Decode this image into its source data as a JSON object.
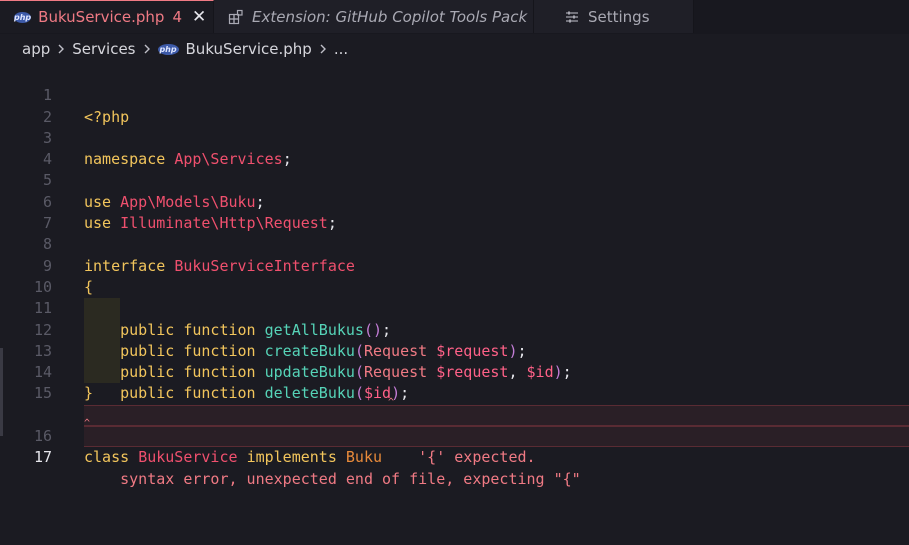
{
  "tabs": [
    {
      "label": "BukuService.php",
      "badge": "4",
      "icon": "php-file-icon",
      "active": true
    },
    {
      "label": "Extension: GitHub Copilot Tools Pack",
      "icon": "extensions-icon",
      "active": false
    },
    {
      "label": "Settings",
      "icon": "settings-sliders-icon",
      "active": false
    }
  ],
  "breadcrumb": [
    "app",
    "Services",
    "BukuService.php",
    "..."
  ],
  "code": {
    "l1": "<?php",
    "l3_kw": "namespace",
    "l3_ns": "App\\Services",
    "l5_kw": "use",
    "l5_ns": "App\\Models\\Buku",
    "l6_kw": "use",
    "l6_ns": "Illuminate\\Http\\Request",
    "l8_kw": "interface",
    "l8_name": "BukuServiceInterface",
    "l9": "{",
    "pub": "public",
    "fn": "function",
    "m1": "getAllBukus",
    "m2": "createBuku",
    "m3": "updateBuku",
    "m4": "deleteBuku",
    "req_type": "Request",
    "req_var": "$request",
    "id_var": "$id",
    "l14": "}",
    "l16_kw": "class",
    "l16_name": "BukuService",
    "l16_impl": "implements",
    "l16_iface": "Buku",
    "l16_err": "'{' expected.",
    "l17_err": "syntax error, unexpected end of file, expecting \"{\""
  },
  "line_numbers": [
    "1",
    "2",
    "3",
    "4",
    "5",
    "6",
    "7",
    "8",
    "9",
    "10",
    "11",
    "12",
    "13",
    "14",
    "15",
    "16",
    "17"
  ]
}
